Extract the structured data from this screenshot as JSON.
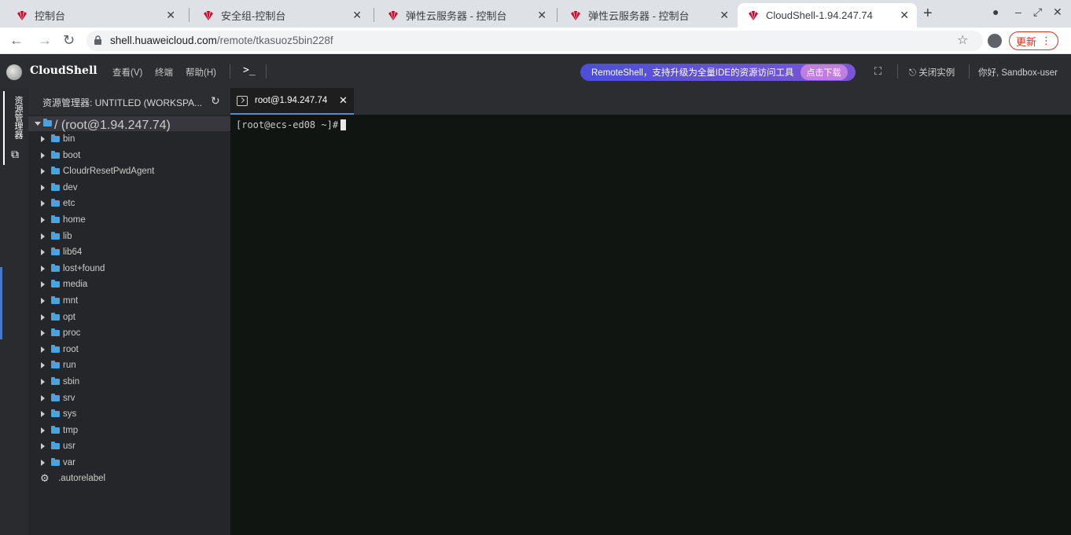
{
  "browser": {
    "tabs": [
      {
        "title": "控制台"
      },
      {
        "title": "安全组-控制台"
      },
      {
        "title": "弹性云服务器 - 控制台"
      },
      {
        "title": "弹性云服务器 - 控制台"
      },
      {
        "title": "CloudShell-1.94.247.74",
        "active": true
      }
    ],
    "new_tab": "+",
    "url_host": "shell.huaweicloud.com",
    "url_path": "/remote/tkasuoz5bin228f",
    "update_label": "更新"
  },
  "app": {
    "brand": "CloudShell",
    "menu": [
      "查看(V)",
      "终端",
      "帮助(H)"
    ],
    "promo_text": "RemoteShell，支持升级为全量IDE的资源访问工具",
    "promo_button": "点击下载",
    "close_instance": "关闭实例",
    "user_greeting": "你好, Sandbox-user"
  },
  "activity_bar": {
    "explorer_label": "资源管理器"
  },
  "explorer": {
    "title": "资源管理器: UNTITLED (WORKSPA...",
    "root": "/ (root@1.94.247.74)",
    "folders": [
      "bin",
      "boot",
      "CloudrResetPwdAgent",
      "dev",
      "etc",
      "home",
      "lib",
      "lib64",
      "lost+found",
      "media",
      "mnt",
      "opt",
      "proc",
      "root",
      "run",
      "sbin",
      "srv",
      "sys",
      "tmp",
      "usr",
      "var"
    ],
    "files": [
      ".autorelabel"
    ]
  },
  "editor": {
    "tab_label": "root@1.94.247.74",
    "prompt": "[root@ecs-ed08 ~]#"
  },
  "colors": {
    "accent": "#4f8fd8",
    "folder": "#4aa3df",
    "terminal_bg": "#111512",
    "promo_start": "#4c4fd8",
    "update_red": "#d93025"
  }
}
